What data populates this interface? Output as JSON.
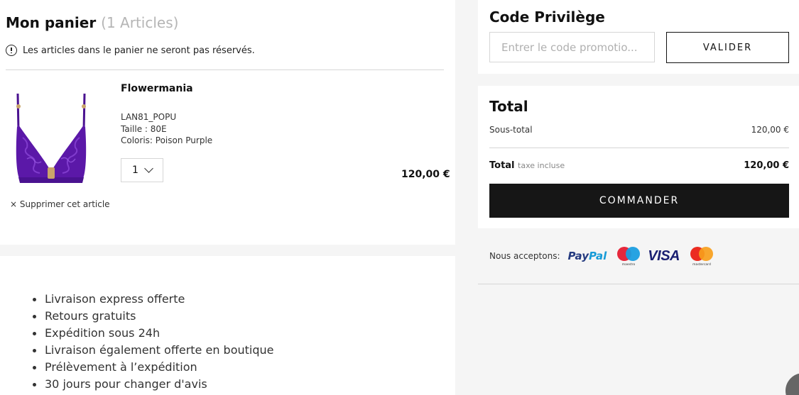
{
  "cart": {
    "title": "Mon panier",
    "count_label": "(1 Articles)",
    "notice": "Les articles dans le panier ne seront pas réservés.",
    "remove_label": "× Supprimer cet article",
    "items": [
      {
        "name": "Flowermania",
        "ref": "LAN81_POPU",
        "size": "Taille : 80E",
        "color": "Coloris: Poison Purple",
        "quantity": "1",
        "price": "120,00 €",
        "image_icon": "purple-lace-bra"
      }
    ]
  },
  "benefits": [
    "Livraison express offerte",
    "Retours gratuits",
    "Expédition sous 24h",
    "Livraison également offerte en boutique",
    "Prélèvement à l’expédition",
    "30 jours pour changer d'avis"
  ],
  "promo": {
    "title": "Code Privilège",
    "placeholder": "Entrer le code promotio...",
    "value": "",
    "button": "VALIDER"
  },
  "total": {
    "title": "Total",
    "subtotal_label": "Sous-total",
    "subtotal_value": "120,00 €",
    "total_label": "Total",
    "tax_note": "taxe incluse",
    "total_value": "120,00 €",
    "checkout_button": "COMMANDER"
  },
  "payments": {
    "label": "Nous acceptons:",
    "paypal_pay": "Pay",
    "paypal_pal": "Pal",
    "maestro_text": "maestro",
    "visa": "VISA",
    "mastercard_text": "mastercard"
  },
  "colors": {
    "checkout_bg": "#161616",
    "page_bg": "#f5f5f5",
    "product_purple": "#5b18a8"
  }
}
